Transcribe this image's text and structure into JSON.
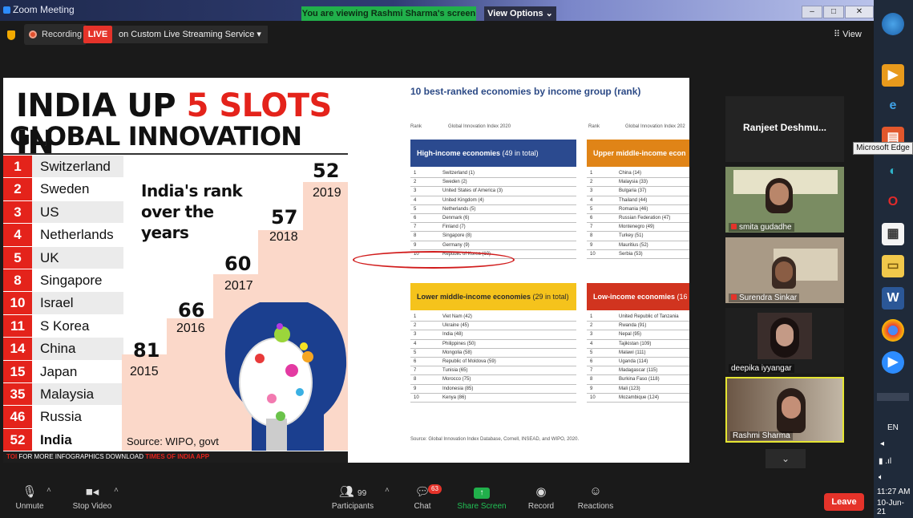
{
  "window": {
    "title": "Zoom Meeting",
    "banner": "You are viewing Rashmi Sharma's screen",
    "view_options": "View Options ⌄",
    "btn_min": "–",
    "btn_max": "□",
    "btn_close": "✕"
  },
  "topbar": {
    "recording": "Recording",
    "live": "LIVE",
    "stream": "on Custom Live Streaming Service  ▾",
    "view": "⠿ View"
  },
  "slide_left": {
    "headline_a": "INDIA UP ",
    "headline_red": "5 SLOTS",
    "headline_b": " IN",
    "headline2": "GLOBAL INNOVATION INDEX",
    "ranks": [
      {
        "rank": "1",
        "country": "Switzerland"
      },
      {
        "rank": "2",
        "country": "Sweden"
      },
      {
        "rank": "3",
        "country": "US"
      },
      {
        "rank": "4",
        "country": "Netherlands"
      },
      {
        "rank": "5",
        "country": "UK"
      },
      {
        "rank": "8",
        "country": "Singapore"
      },
      {
        "rank": "10",
        "country": "Israel"
      },
      {
        "rank": "11",
        "country": "S Korea"
      },
      {
        "rank": "14",
        "country": "China"
      },
      {
        "rank": "15",
        "country": "Japan"
      },
      {
        "rank": "35",
        "country": "Malaysia"
      },
      {
        "rank": "46",
        "country": "Russia"
      },
      {
        "rank": "52",
        "country": "India"
      }
    ],
    "over_line1": "India's rank",
    "over_line2": "over the",
    "over_line3": "years",
    "years": [
      {
        "rank": "81",
        "year": "2015"
      },
      {
        "rank": "66",
        "year": "2016"
      },
      {
        "rank": "60",
        "year": "2017"
      },
      {
        "rank": "57",
        "year": "2018"
      },
      {
        "rank": "52",
        "year": "2019"
      }
    ],
    "source": "Source: WIPO, govt",
    "footer_toi": "TOI",
    "footer_text": "FOR MORE INFOGRAPHICS DOWNLOAD",
    "footer_app": "TIMES OF INDIA APP"
  },
  "slide_right": {
    "title": "10 best-ranked economies by income group (rank)",
    "col_rank": "Rank",
    "col_gii": "Global Innovation Index 2020",
    "col_gii2": "Global Innovation Index 202",
    "high_title": "High-income economies",
    "high_count": "(49 in total)",
    "upper_title": "Upper middle-income econ",
    "lower_title": "Lower middle-income economies",
    "lower_count": "(29 in total)",
    "low_title": "Low-income economies",
    "low_count": "(16",
    "high": [
      "Switzerland (1)",
      "Sweden (2)",
      "United States of America (3)",
      "United Kingdom (4)",
      "Netherlands (5)",
      "Denmark (6)",
      "Finland (7)",
      "Singapore (8)",
      "Germany (9)",
      "Republic of Korea (10)"
    ],
    "upper": [
      "China (14)",
      "Malaysia (33)",
      "Bulgaria (37)",
      "Thailand (44)",
      "Romania (46)",
      "Russian Federation (47)",
      "Montenegro (49)",
      "Turkey (51)",
      "Mauritius (52)",
      "Serbia (53)"
    ],
    "lower": [
      "Viet Nam (42)",
      "Ukraine (45)",
      "India (48)",
      "Philippines (50)",
      "Mongolia (58)",
      "Republic of Moldova (59)",
      "Tunisia (65)",
      "Morocco (75)",
      "Indonesia (85)",
      "Kenya (86)"
    ],
    "low": [
      "United Republic of Tanzania",
      "Rwanda (91)",
      "Nepal (95)",
      "Tajikistan (109)",
      "Malawi (111)",
      "Uganda (114)",
      "Madagascar (115)",
      "Burkina Faso (118)",
      "Mali (123)",
      "Mozambique (124)"
    ],
    "source": "Source: Global Innovation Index Database, Cornell, INSEAD, and WIPO, 2020."
  },
  "participants": [
    {
      "name": "Ranjeet  Deshmu..."
    },
    {
      "name": "smita gudadhe"
    },
    {
      "name": "Surendra Sinkar"
    },
    {
      "name": "deepika iyyangar"
    },
    {
      "name": "Rashmi Sharma"
    }
  ],
  "toolbar": {
    "unmute": "Unmute",
    "stop_video": "Stop Video",
    "participants": "Participants",
    "participants_count": "99",
    "chat": "Chat",
    "chat_badge": "63",
    "share": "Share Screen",
    "record": "Record",
    "reactions": "Reactions",
    "leave": "Leave"
  },
  "taskbar": {
    "tooltip": "Microsoft Edge",
    "lang": "EN",
    "time": "11:27 AM",
    "date": "10-Jun-21"
  }
}
